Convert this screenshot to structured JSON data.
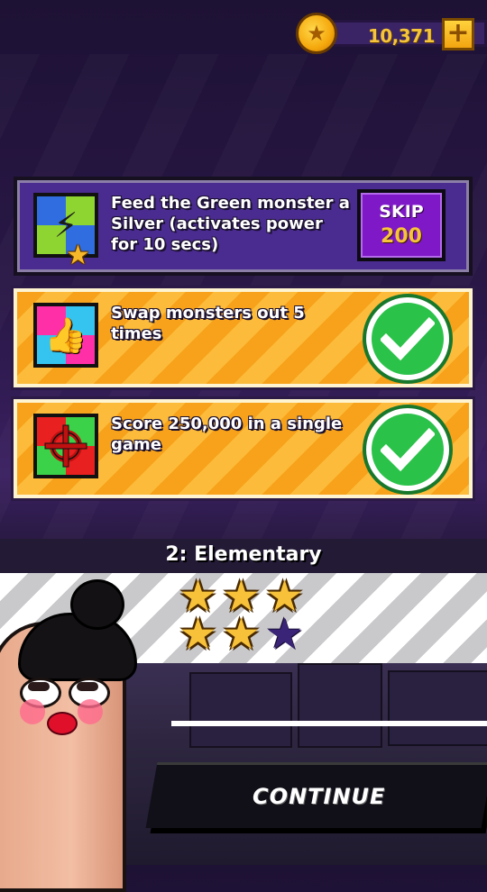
{
  "coins": {
    "amount": "10,371",
    "add_label": "+"
  },
  "missions": [
    {
      "text": "Feed the Green monster a Silver (activates power for 10 secs)",
      "status": "active",
      "skip_label": "SKIP",
      "skip_cost": "200",
      "icon": "lightning-bolt-icon"
    },
    {
      "text": "Swap monsters out 5 times",
      "status": "complete",
      "icon": "thumbs-up-icon"
    },
    {
      "text": "Score 250,000 in a single game",
      "status": "complete",
      "icon": "crosshair-icon"
    }
  ],
  "level": {
    "title": "2: Elementary",
    "stars_earned": 5,
    "stars_total": 6
  },
  "continue_label": "CONTINUE",
  "colors": {
    "gold": "#f6c43a",
    "purple": "#4a2b8f",
    "orange": "#f7a21a",
    "green": "#2bc24a"
  }
}
